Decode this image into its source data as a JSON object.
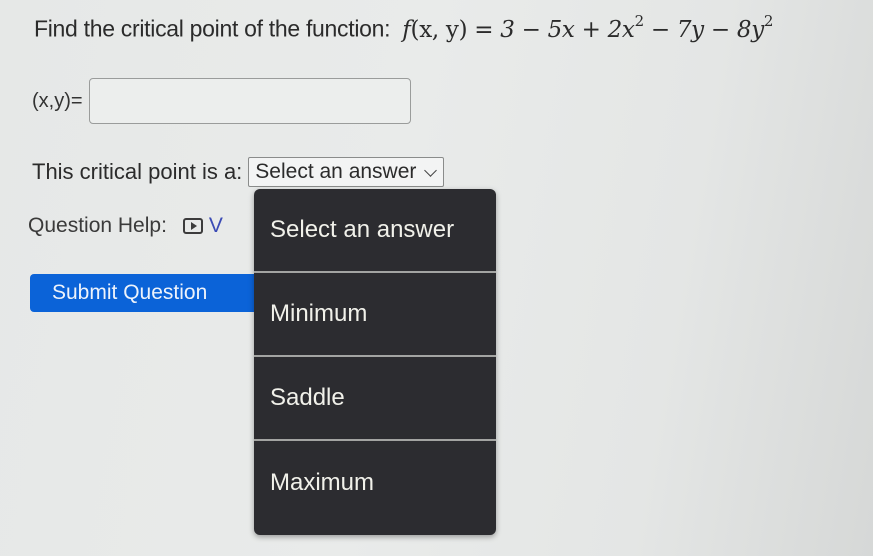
{
  "question": {
    "prompt": "Find the critical point of the function:",
    "function_name": "f",
    "function_args": "(x, y)",
    "equals": "=",
    "expression_parts": {
      "t1": "3 − 5x + 2x",
      "t1_exp": "2",
      "t2": " − 7y − 8y",
      "t2_exp": "2"
    }
  },
  "answer": {
    "label": "(x,y)=",
    "value": "",
    "placeholder": ""
  },
  "classification": {
    "label": "This critical point is a:",
    "selected": "Select an answer",
    "options": [
      "Select an answer",
      "Minimum",
      "Saddle",
      "Maximum"
    ],
    "dropdown_open": true
  },
  "help": {
    "label": "Question Help:",
    "video_icon": "video-icon",
    "video_link_visible_text": "V"
  },
  "submit": {
    "label": "Submit Question"
  },
  "colors": {
    "submit_blue": "#0b63d8",
    "dropdown_bg": "#2c2c30",
    "link_color": "#3b4bb5"
  }
}
